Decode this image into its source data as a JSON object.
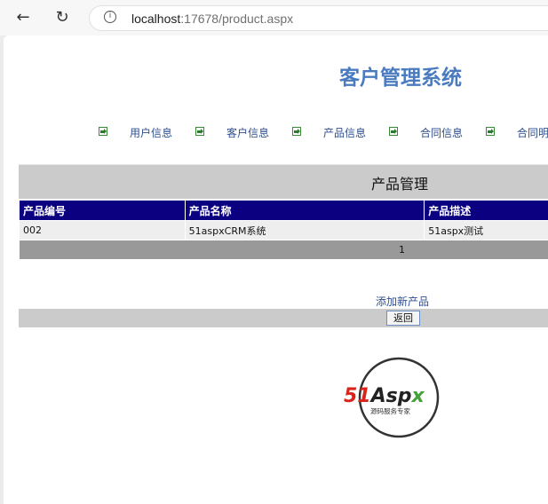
{
  "browser": {
    "url_host": "localhost",
    "url_rest": ":17678/product.aspx"
  },
  "app": {
    "title": "客户管理系统",
    "menu": [
      "用户信息",
      "客户信息",
      "产品信息",
      "合同信息",
      "合同明"
    ]
  },
  "grid": {
    "title": "产品管理",
    "columns": [
      "产品编号",
      "产品名称",
      "产品描述"
    ],
    "rows": [
      [
        "002",
        "51aspxCRM系统",
        "51aspx测试"
      ]
    ],
    "pager": "1"
  },
  "actions": {
    "add_label": "添加新产品",
    "back_label": "返回"
  },
  "logo": {
    "brand": "51Aspx",
    "tagline": "源码服务专家"
  },
  "colors": {
    "title": "#4a7bbf",
    "header_bg": "#0a0080",
    "link": "#2f4f8f",
    "menu_icon": "#2c7a2c"
  }
}
